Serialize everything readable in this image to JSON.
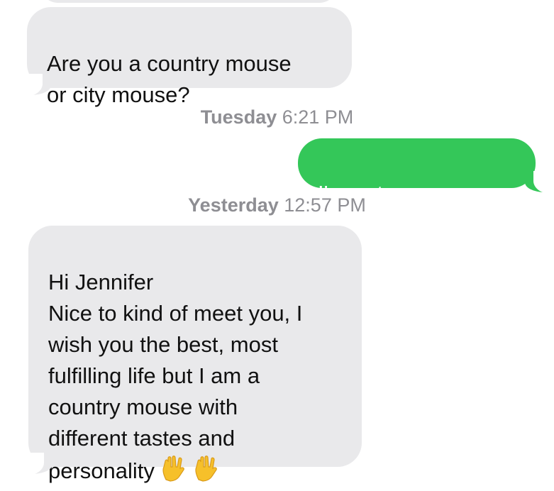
{
  "messages": [
    {
      "direction": "received",
      "text": "Are you a country mouse\nor city mouse?"
    },
    {
      "direction": "sent",
      "text": "I'm not a mouse..."
    },
    {
      "direction": "received",
      "text": "Hi Jennifer\nNice to kind of meet you, I\nwish you the best, most\nfulfilling life but I am a\ncountry mouse with\ndifferent tastes and\npersonality",
      "trailing_emoji": [
        "vulcan-salute-emoji",
        "vulcan-salute-emoji"
      ]
    }
  ],
  "timestamps": [
    {
      "day": "Tuesday",
      "time": "6:21 PM"
    },
    {
      "day": "Yesterday",
      "time": "12:57 PM"
    }
  ],
  "colors": {
    "received_bubble": "#e9e9eb",
    "sent_bubble": "#34c759",
    "timestamp_text": "#8e8e93"
  }
}
